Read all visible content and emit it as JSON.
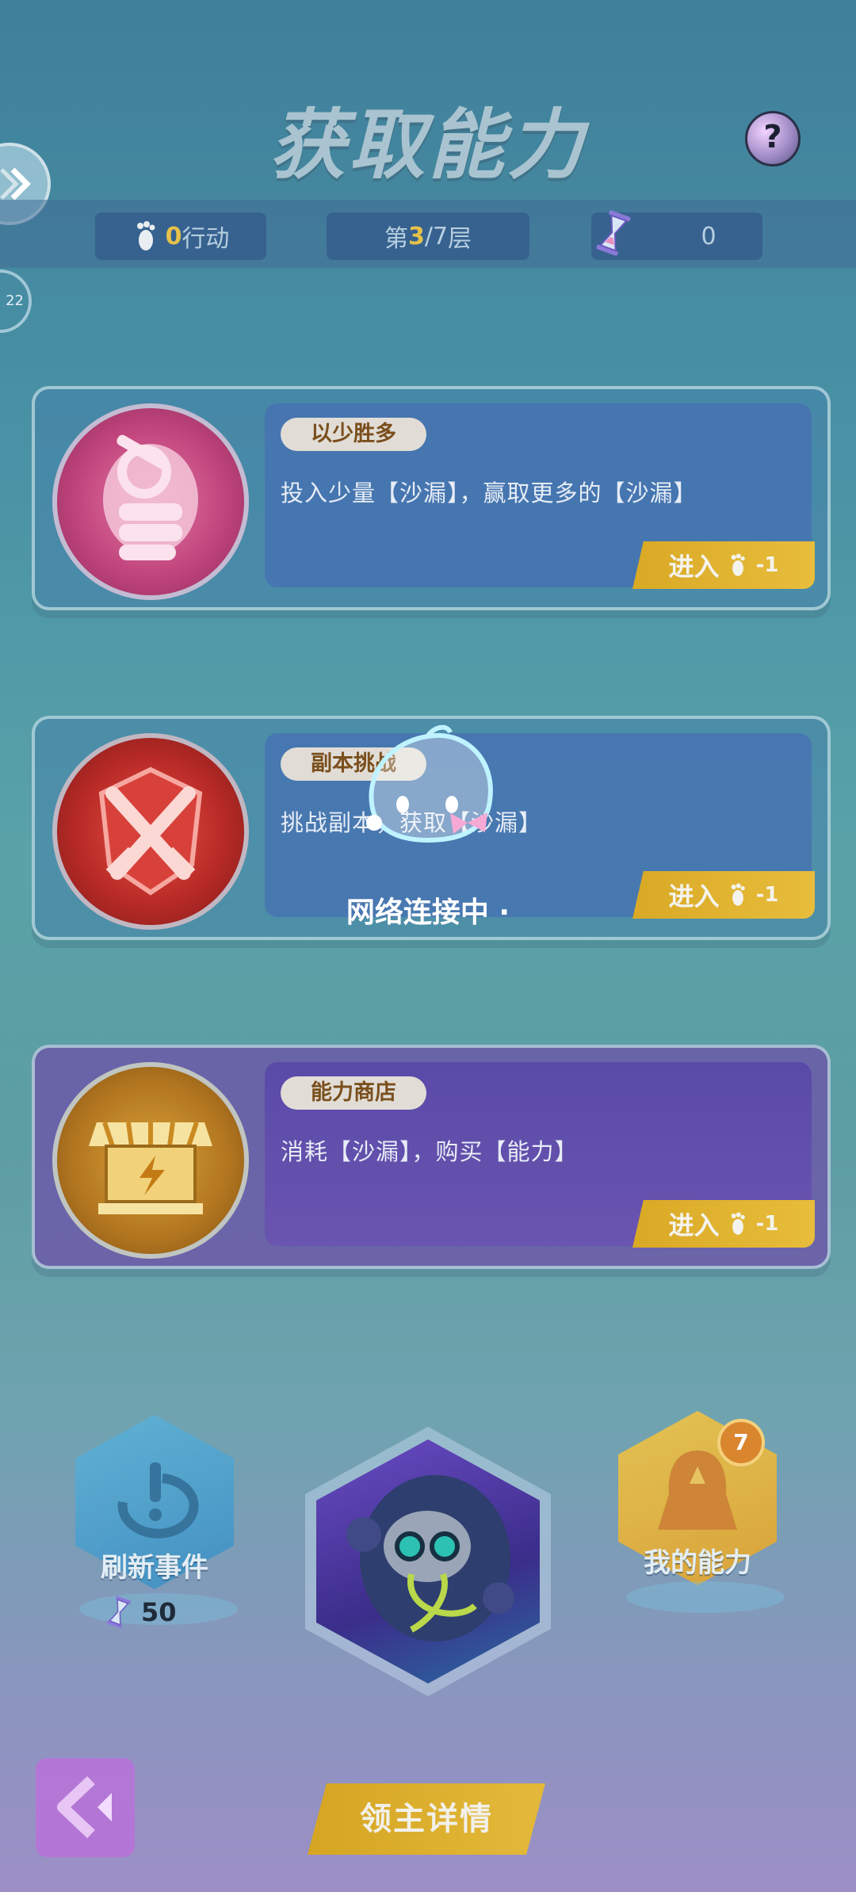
{
  "header": {
    "title": "获取能力",
    "help_label": "?",
    "side_label": "22"
  },
  "status": {
    "actions_value": "0",
    "actions_unit": "行动",
    "floor_prefix": "第",
    "floor_current": "3",
    "floor_sep": "/",
    "floor_total": "7",
    "floor_suffix": "层",
    "hourglass_count": "0"
  },
  "cards": [
    {
      "tag": "以少胜多",
      "desc": "投入少量【沙漏】，赢取更多的【沙漏】",
      "enter_label": "进入",
      "enter_cost": "-1",
      "icon": "fist-icon"
    },
    {
      "tag": "副本挑战",
      "desc": "挑战副本，获取【沙漏】",
      "enter_label": "进入",
      "enter_cost": "-1",
      "icon": "crossed-swords-icon"
    },
    {
      "tag": "能力商店",
      "desc": "消耗【沙漏】，购买【能力】",
      "enter_label": "进入",
      "enter_cost": "-1",
      "icon": "shop-icon"
    }
  ],
  "loading": {
    "text": "网络连接中 ·"
  },
  "bottom": {
    "refresh_label": "刷新事件",
    "refresh_cost": "50",
    "abilities_label": "我的能力",
    "abilities_count": "7",
    "lord_details_label": "领主详情"
  },
  "colors": {
    "accent_gold": "#e0b430",
    "highlight": "#e6c24a",
    "card_blue": "#4d82b4",
    "card_purple": "#6a55b0"
  }
}
